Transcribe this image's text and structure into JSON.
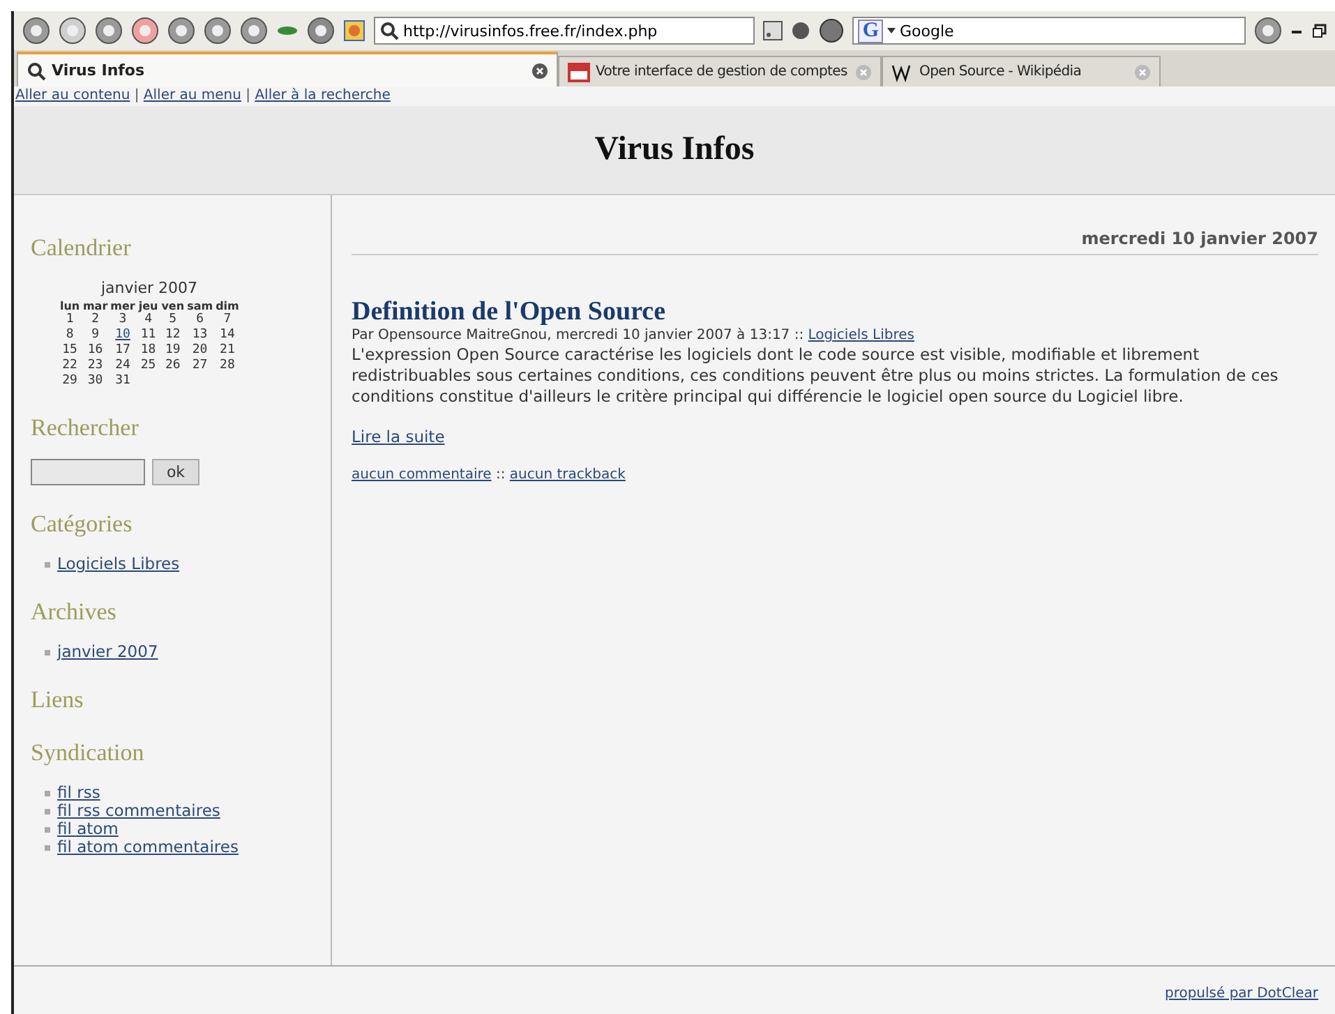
{
  "toolbar": {
    "address": "http://virusinfos.free.fr/index.php",
    "search_engine": "G",
    "search": "Google"
  },
  "tabs": [
    {
      "label": "Virus Infos",
      "selected": true
    },
    {
      "label": "Votre interface de gestion de comptes",
      "selected": false
    },
    {
      "label": "Open Source - Wikipédia",
      "selected": false
    }
  ],
  "skip_links": [
    "Aller au contenu",
    "Aller au menu",
    "Aller à la recherche"
  ],
  "skip_separator": "|",
  "site_title": "Virus Infos",
  "sidebar": {
    "calendar": {
      "title": "Calendrier",
      "month": "janvier 2007",
      "weekdays": [
        "lun",
        "mar",
        "mer",
        "jeu",
        "ven",
        "sam",
        "dim"
      ],
      "weeks": [
        [
          {
            "day": "1",
            "link": false
          },
          {
            "day": "2",
            "link": false
          },
          {
            "day": "3",
            "link": false
          },
          {
            "day": "4",
            "link": false
          },
          {
            "day": "5",
            "link": false
          },
          {
            "day": "6",
            "link": false
          },
          {
            "day": "7",
            "link": false
          }
        ],
        [
          {
            "day": "8",
            "link": false
          },
          {
            "day": "9",
            "link": false
          },
          {
            "day": "10",
            "link": true
          },
          {
            "day": "11",
            "link": false
          },
          {
            "day": "12",
            "link": false
          },
          {
            "day": "13",
            "link": false
          },
          {
            "day": "14",
            "link": false
          }
        ],
        [
          {
            "day": "15",
            "link": false
          },
          {
            "day": "16",
            "link": false
          },
          {
            "day": "17",
            "link": false
          },
          {
            "day": "18",
            "link": false
          },
          {
            "day": "19",
            "link": false
          },
          {
            "day": "20",
            "link": false
          },
          {
            "day": "21",
            "link": false
          }
        ],
        [
          {
            "day": "22",
            "link": false
          },
          {
            "day": "23",
            "link": false
          },
          {
            "day": "24",
            "link": false
          },
          {
            "day": "25",
            "link": false
          },
          {
            "day": "26",
            "link": false
          },
          {
            "day": "27",
            "link": false
          },
          {
            "day": "28",
            "link": false
          }
        ],
        [
          {
            "day": "29",
            "link": false
          },
          {
            "day": "30",
            "link": false
          },
          {
            "day": "31",
            "link": false
          }
        ]
      ]
    },
    "search": {
      "title": "Rechercher",
      "button": "ok"
    },
    "sections": [
      {
        "title": "Catégories",
        "links": [
          "Logiciels Libres"
        ]
      },
      {
        "title": "Archives",
        "links": [
          "janvier 2007"
        ]
      },
      {
        "title": "Liens"
      },
      {
        "title": "Syndication",
        "links": [
          "fil rss",
          "fil rss commentaires",
          "fil atom",
          "fil atom commentaires"
        ]
      }
    ]
  },
  "main": {
    "date": "mercredi 10 janvier 2007",
    "post": {
      "title": "Definition de l'Open Source",
      "meta": "Par Opensource MaitreGnou, mercredi 10 janvier 2007 à 13:17 ::",
      "category": "Logiciels Libres",
      "body": "L'expression Open Source caractérise les logiciels dont le code source est visible, modifiable et librement redistribuables sous certaines conditions, ces conditions peuvent être plus ou moins strictes. La formulation de ces conditions constitue d'ailleurs le critère principal qui différencie le logiciel open source du Logiciel libre.",
      "read_more": "Lire la suite",
      "comments": "aucun commentaire",
      "separator": "::",
      "trackbacks": "aucun trackback"
    }
  },
  "footer": "propulsé par DotClear"
}
